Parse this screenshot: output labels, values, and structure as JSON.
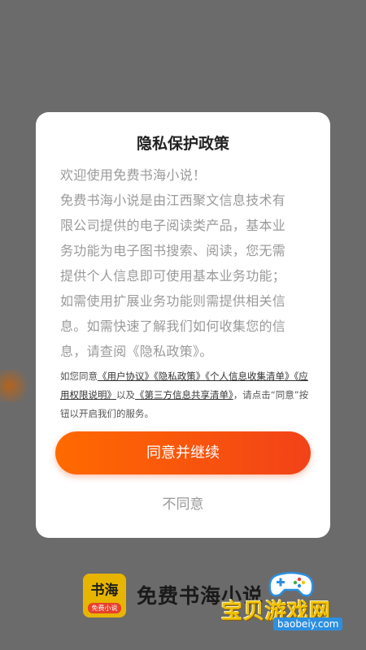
{
  "dialog": {
    "title": "隐私保护政策",
    "body_lines": [
      "欢迎使用免费书海小说！",
      "免费书海小说是由江西聚文信息技术有",
      "限公司提供的电子阅读类产品，基本业",
      "务功能为电子图书搜索、阅读，您无需",
      "提供个人信息即可使用基本业务功能；",
      "如需使用扩展业务功能则需提供相关信",
      "息。如需快速了解我们如何收集您的信",
      "息，请查阅《隐私政策》。"
    ],
    "consent": {
      "prefix": "如您同意",
      "link_user_agreement": "《用户协议》",
      "link_privacy_policy": "《隐私政策》",
      "link_info_collection": "《个人信息收集清单》",
      "link_permissions": "《应用权限说明》",
      "joiner": "以及",
      "link_third_party": "《第三方信息共享清单》",
      "suffix": "，请点击“同意”按钮以开启我们的服务。"
    },
    "agree_label": "同意并继续",
    "disagree_label": "不同意"
  },
  "brand": {
    "logo_top": "书海",
    "logo_bottom": "免费小说",
    "app_name": "免费书海小说"
  },
  "watermark": {
    "text": "宝贝游戏网",
    "url": "baobeiy.com",
    "icon": "gamepad-icon"
  },
  "colors": {
    "overlay": "#6b6b6b",
    "accent_start": "#ff6a00",
    "accent_end": "#f24218",
    "logo_bg": "#e7b500"
  }
}
